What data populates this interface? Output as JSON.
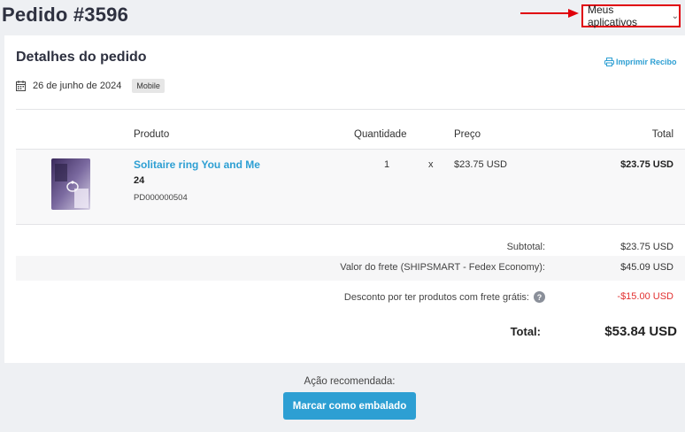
{
  "header": {
    "title": "Pedido #3596",
    "apps_button_label": "Meus aplicativos",
    "annotation_color": "#e0000a"
  },
  "order_details": {
    "section_title": "Detalhes do pedido",
    "print_label": "Imprimir Recibo",
    "date": "26 de junho de 2024",
    "channel_badge": "Mobile"
  },
  "table": {
    "headers": {
      "product": "Produto",
      "quantity": "Quantidade",
      "price": "Preço",
      "total": "Total"
    },
    "items": [
      {
        "name": "Solitaire ring You and Me",
        "variant": "24",
        "sku": "PD000000504",
        "quantity": "1",
        "times": "x",
        "unit_price": "$23.75 USD",
        "line_total": "$23.75 USD"
      }
    ]
  },
  "summary": {
    "subtotal_label": "Subtotal:",
    "subtotal_value": "$23.75 USD",
    "shipping_label": "Valor do frete (SHIPSMART - Fedex Economy):",
    "shipping_value": "$45.09 USD",
    "discount_label": "Desconto por ter produtos com frete grátis:",
    "discount_value": "-$15.00 USD",
    "total_label": "Total:",
    "total_value": "$53.84 USD"
  },
  "action": {
    "label": "Ação recomendada:",
    "button_label": "Marcar como embalado"
  },
  "colors": {
    "accent": "#2d9fd3",
    "discount": "#e23030"
  }
}
